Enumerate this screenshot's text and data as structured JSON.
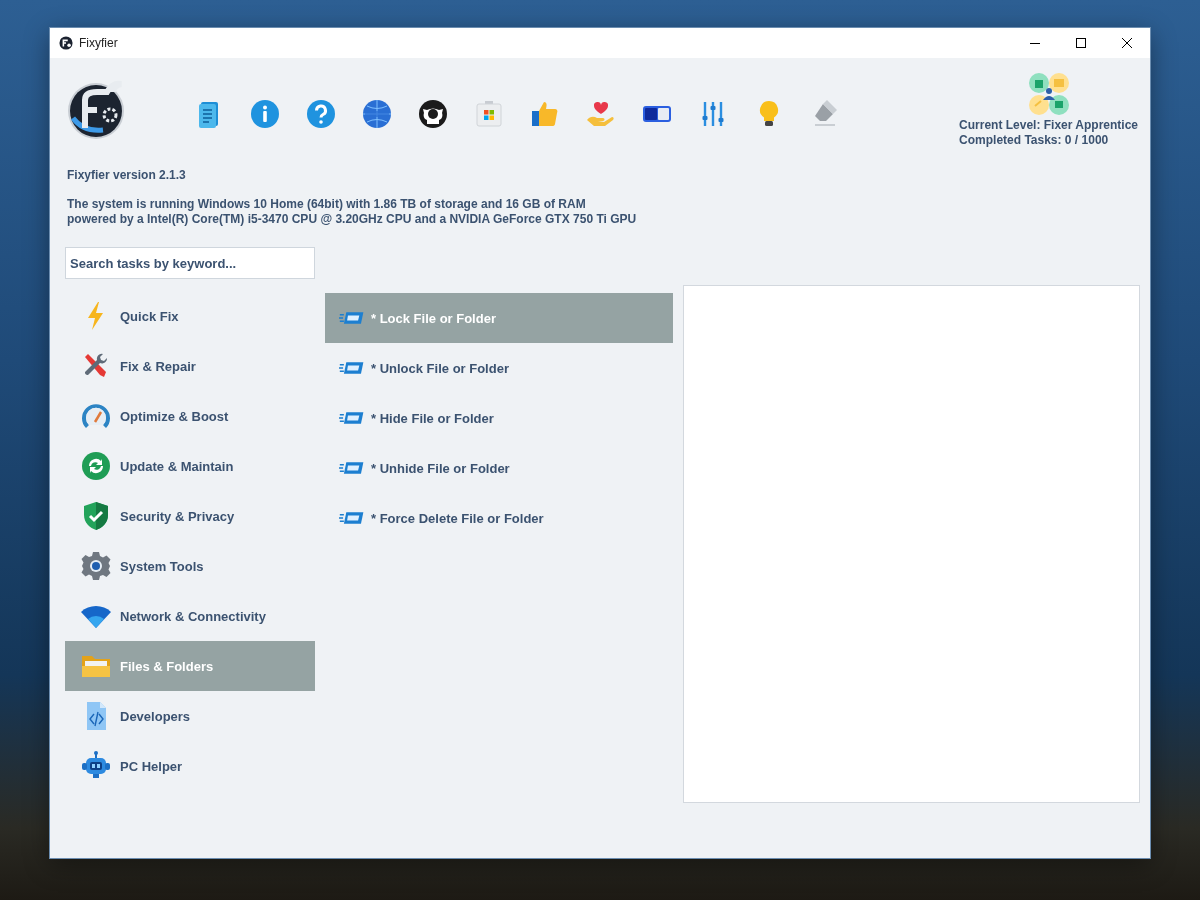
{
  "window": {
    "title": "Fixyfier"
  },
  "level": {
    "current": "Current Level: Fixer Apprentice",
    "completed": "Completed Tasks: 0 / 1000"
  },
  "version": "Fixyfier version 2.1.3",
  "system_info": [
    "The system is running Windows 10 Home (64bit) with 1.86 TB of storage and 16 GB of RAM",
    "powered by a Intel(R) Core(TM) i5-3470 CPU @ 3.20GHz CPU and a NVIDIA GeForce GTX 750 Ti GPU"
  ],
  "search": {
    "placeholder": "Search tasks by keyword..."
  },
  "categories": [
    {
      "label": "Quick Fix",
      "selected": false
    },
    {
      "label": "Fix & Repair",
      "selected": false
    },
    {
      "label": "Optimize & Boost",
      "selected": false
    },
    {
      "label": "Update & Maintain",
      "selected": false
    },
    {
      "label": "Security & Privacy",
      "selected": false
    },
    {
      "label": "System Tools",
      "selected": false
    },
    {
      "label": "Network & Connectivity",
      "selected": false
    },
    {
      "label": "Files & Folders",
      "selected": true
    },
    {
      "label": "Developers",
      "selected": false
    },
    {
      "label": "PC Helper",
      "selected": false
    }
  ],
  "tasks": [
    {
      "label": "* Lock File or Folder",
      "selected": true
    },
    {
      "label": "* Unlock File or Folder",
      "selected": false
    },
    {
      "label": "* Hide File or Folder",
      "selected": false
    },
    {
      "label": "* Unhide File or Folder",
      "selected": false
    },
    {
      "label": "* Force Delete File or Folder",
      "selected": false
    }
  ]
}
